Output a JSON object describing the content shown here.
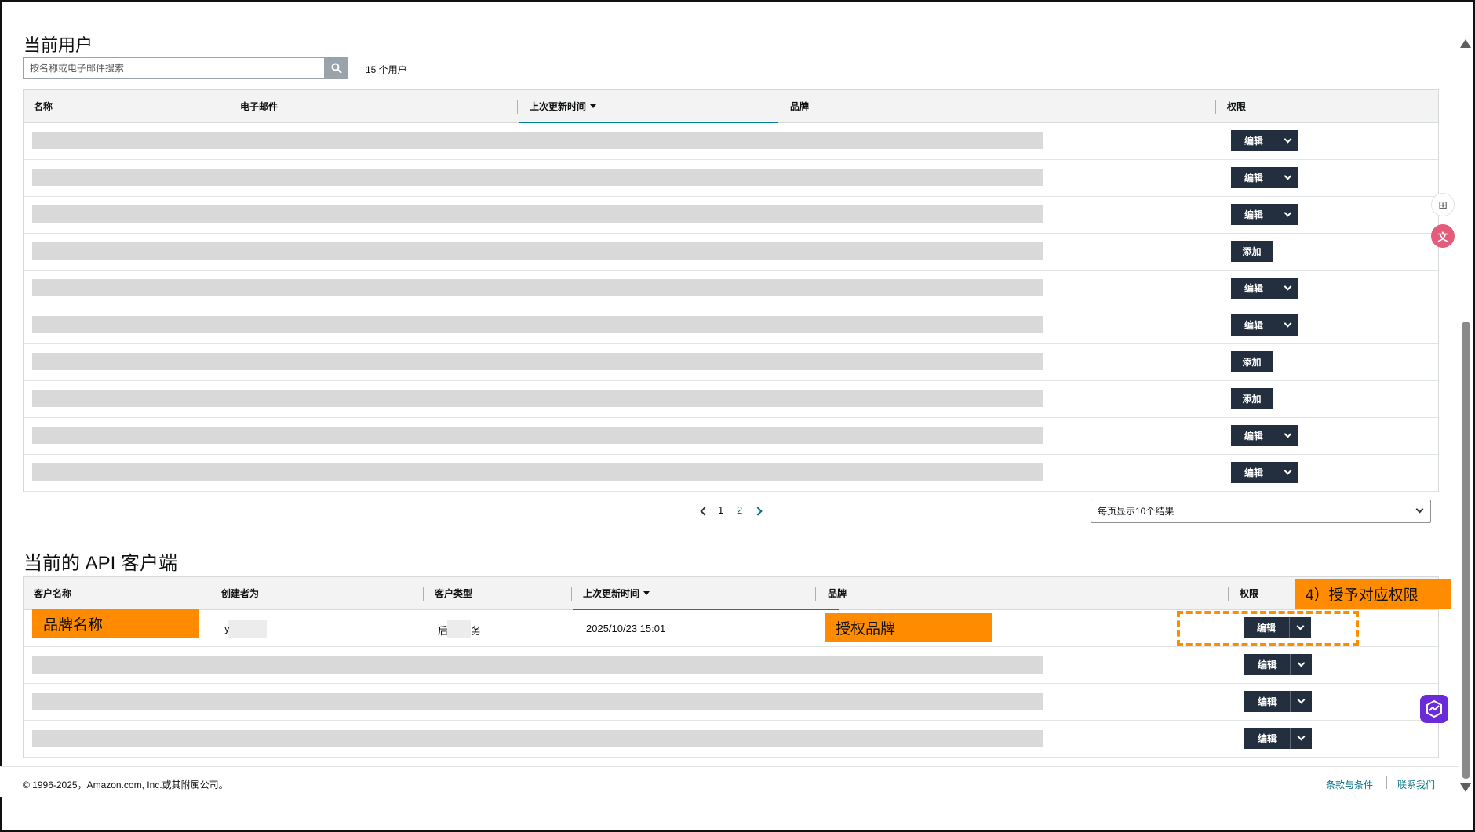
{
  "users_section": {
    "title": "当前用户",
    "search_placeholder": "按名称或电子邮件搜索",
    "search_icon": "search-icon",
    "user_count": "15 个用户",
    "columns": [
      "名称",
      "电子邮件",
      "上次更新时间",
      "品牌",
      "权限"
    ],
    "rows": [
      {
        "action": "编辑",
        "has_dropdown": true
      },
      {
        "action": "编辑",
        "has_dropdown": true
      },
      {
        "action": "编辑",
        "has_dropdown": true
      },
      {
        "action": "添加",
        "has_dropdown": false
      },
      {
        "action": "编辑",
        "has_dropdown": true
      },
      {
        "action": "编辑",
        "has_dropdown": true
      },
      {
        "action": "添加",
        "has_dropdown": false
      },
      {
        "action": "添加",
        "has_dropdown": false
      },
      {
        "action": "编辑",
        "has_dropdown": true
      },
      {
        "action": "编辑",
        "has_dropdown": true
      }
    ]
  },
  "pagination": {
    "pages": [
      "1",
      "2"
    ],
    "current_page": "2",
    "per_page_selected": "每页显示10个结果"
  },
  "api_section": {
    "title": "当前的 API 客户端",
    "columns": [
      "客户名称",
      "创建者为",
      "客户类型",
      "上次更新时间",
      "品牌",
      "权限"
    ],
    "first_row": {
      "client_name_annotation": "品牌名称",
      "creator_partial": "y",
      "client_type_prefix": "后",
      "client_type_suffix": "务",
      "updated_at": "2025/10/23 15:01",
      "brand_annotation": "授权品牌",
      "action": "编辑"
    },
    "other_rows": [
      {
        "action": "编辑"
      },
      {
        "action": "编辑"
      },
      {
        "action": "编辑"
      }
    ],
    "step_annotation": "4）授予对应权限"
  },
  "footer": {
    "copyright": "© 1996-2025，Amazon.com, Inc.或其附属公司。",
    "terms_link": "条款与条件",
    "contact_link": "联系我们"
  },
  "colors": {
    "accent_button": "#232f3e",
    "annotation_orange": "#ff8c00",
    "link": "#007185",
    "sort_underline": "#008296"
  }
}
